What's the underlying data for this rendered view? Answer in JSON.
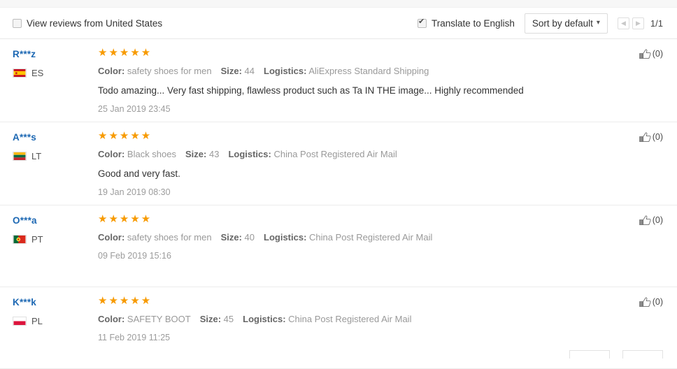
{
  "toolbar": {
    "view_reviews_label": "View reviews from United States",
    "view_reviews_checked": false,
    "translate_label": "Translate to English",
    "translate_checked": true,
    "sort_label": "Sort by default",
    "sort_caret": "chevron-down-icon",
    "prev_glyph": "◀",
    "next_glyph": "▶",
    "page_count": "1/1"
  },
  "labels": {
    "color": "Color:",
    "size": "Size:",
    "logistics": "Logistics:",
    "stars": "★★★★★"
  },
  "reviews": [
    {
      "name": "R***z",
      "country_code": "ES",
      "flag": "flag-spain",
      "rating": 5,
      "color": "safety shoes for men",
      "size": "44",
      "logistics": "AliExpress Standard Shipping",
      "text": "Todo amazing... Very fast shipping, flawless product such as Ta IN THE image... Highly recommended",
      "date": "25 Jan 2019 23:45",
      "likes": "(0)"
    },
    {
      "name": "A***s",
      "country_code": "LT",
      "flag": "flag-lithuania",
      "rating": 5,
      "color": "Black shoes",
      "size": "43",
      "logistics": "China Post Registered Air Mail",
      "text": "Good and very fast.",
      "date": "19 Jan 2019 08:30",
      "likes": "(0)"
    },
    {
      "name": "O***a",
      "country_code": "PT",
      "flag": "flag-portugal",
      "rating": 5,
      "color": "safety shoes for men",
      "size": "40",
      "logistics": "China Post Registered Air Mail",
      "text": "",
      "date": "09 Feb 2019 15:16",
      "likes": "(0)"
    },
    {
      "name": "K***k",
      "country_code": "PL",
      "flag": "flag-poland",
      "rating": 5,
      "color": "SAFETY BOOT",
      "size": "45",
      "logistics": "China Post Registered Air Mail",
      "text": "",
      "date": "11 Feb 2019 11:25",
      "likes": "(0)"
    }
  ],
  "colors": {
    "star": "#f79a00",
    "username": "#1d68b3",
    "muted": "#999999",
    "label": "#666666"
  }
}
